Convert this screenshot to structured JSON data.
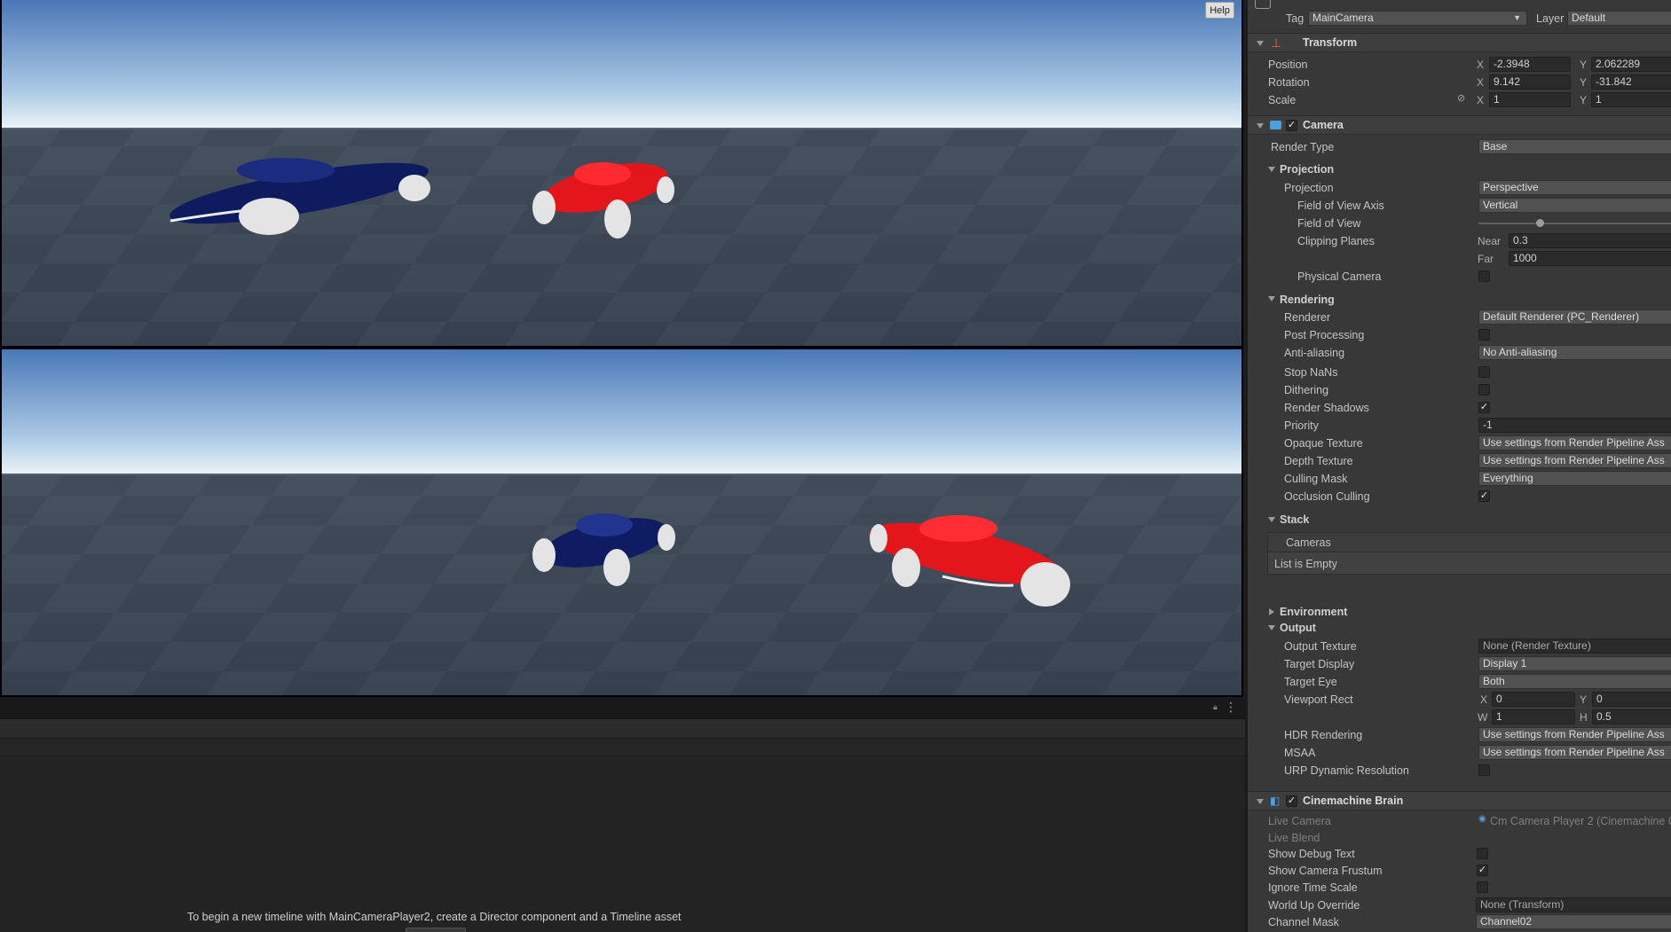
{
  "game_view": {
    "help_label": "Help"
  },
  "timeline": {
    "message": "To begin a new timeline with MainCameraPlayer2, create a Director component and a Timeline asset"
  },
  "inspector": {
    "tag_label": "Tag",
    "tag_value": "MainCamera",
    "layer_label": "Layer",
    "layer_value": "Default",
    "transform": {
      "title": "Transform",
      "position_label": "Position",
      "rotation_label": "Rotation",
      "scale_label": "Scale",
      "pos_x": "-2.3948",
      "pos_y": "2.062289",
      "rot_x": "9.142",
      "rot_y": "-31.842",
      "scale_x": "1",
      "scale_y": "1",
      "axis_x": "X",
      "axis_y": "Y"
    },
    "camera": {
      "title": "Camera",
      "render_type_label": "Render Type",
      "render_type_value": "Base",
      "projection_section": "Projection",
      "projection_label": "Projection",
      "projection_value": "Perspective",
      "fov_axis_label": "Field of View Axis",
      "fov_axis_value": "Vertical",
      "fov_label": "Field of View",
      "fov_fraction": 0.3,
      "clipping_label": "Clipping Planes",
      "near_label": "Near",
      "near_value": "0.3",
      "far_label": "Far",
      "far_value": "1000",
      "physical_label": "Physical Camera",
      "rendering_section": "Rendering",
      "renderer_label": "Renderer",
      "renderer_value": "Default Renderer (PC_Renderer)",
      "post_label": "Post Processing",
      "aa_label": "Anti-aliasing",
      "aa_value": "No Anti-aliasing",
      "stopnans_label": "Stop NaNs",
      "dither_label": "Dithering",
      "shadows_label": "Render Shadows",
      "priority_label": "Priority",
      "priority_value": "-1",
      "opaque_label": "Opaque Texture",
      "opaque_value": "Use settings from Render Pipeline Ass",
      "depth_label": "Depth Texture",
      "depth_value": "Use settings from Render Pipeline Ass",
      "culling_label": "Culling Mask",
      "culling_value": "Everything",
      "occlusion_label": "Occlusion Culling",
      "stack_section": "Stack",
      "stack_cameras": "Cameras",
      "stack_empty": "List is Empty",
      "environment_section": "Environment",
      "output_section": "Output",
      "out_tex_label": "Output Texture",
      "out_tex_value": "None (Render Texture)",
      "target_display_label": "Target Display",
      "target_display_value": "Display 1",
      "target_eye_label": "Target Eye",
      "target_eye_value": "Both",
      "viewport_label": "Viewport Rect",
      "vp_x": "0",
      "vp_y": "0",
      "vp_w": "1",
      "vp_h": "0.5",
      "axis_w": "W",
      "axis_h": "H",
      "hdr_label": "HDR Rendering",
      "hdr_value": "Use settings from Render Pipeline Ass",
      "msaa_label": "MSAA",
      "msaa_value": "Use settings from Render Pipeline Ass",
      "urp_label": "URP Dynamic Resolution"
    },
    "brain": {
      "title": "Cinemachine Brain",
      "live_camera_label": "Live Camera",
      "live_camera_value": "Cm Camera Player 2 (Cinemachine C",
      "live_blend_label": "Live Blend",
      "debug_label": "Show Debug Text",
      "frustum_label": "Show Camera Frustum",
      "ignore_label": "Ignore Time Scale",
      "worldup_label": "World Up Override",
      "worldup_value": "None (Transform)",
      "channel_label": "Channel Mask",
      "channel_value": "Channel02"
    },
    "check_glyph": "✓"
  },
  "colors": {
    "inspector_bg": "#383838",
    "field_bg": "#2a2a2a",
    "sky_top": "#4f7bb8",
    "ground": "#3a4556",
    "car_blue": "#101e64",
    "car_red": "#e8161c",
    "wheel": "#e6e6e6"
  }
}
